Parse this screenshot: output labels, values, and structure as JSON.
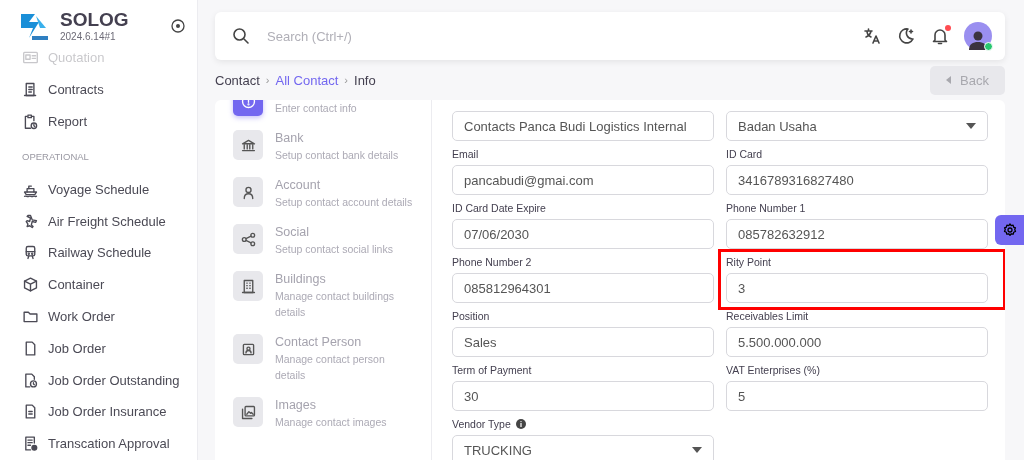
{
  "brand": {
    "name": "SOLOG",
    "version": "2024.6.14#1"
  },
  "sidebar": {
    "items": [
      {
        "kind": "item",
        "label": "Quotation",
        "faded": true
      },
      {
        "kind": "item",
        "label": "Contracts",
        "faded": false
      },
      {
        "kind": "item",
        "label": "Report",
        "faded": false
      },
      {
        "kind": "section",
        "label": "OPERATIONAL",
        "faded": false
      },
      {
        "kind": "item",
        "label": "Voyage Schedule",
        "faded": false
      },
      {
        "kind": "item",
        "label": "Air Freight Schedule",
        "faded": false
      },
      {
        "kind": "item",
        "label": "Railway Schedule",
        "faded": false
      },
      {
        "kind": "item",
        "label": "Container",
        "faded": false
      },
      {
        "kind": "item",
        "label": "Work Order",
        "faded": false
      },
      {
        "kind": "item",
        "label": "Job Order",
        "faded": false
      },
      {
        "kind": "item",
        "label": "Job Order Outstanding",
        "faded": false
      },
      {
        "kind": "item",
        "label": "Job Order Insurance",
        "faded": false
      },
      {
        "kind": "item",
        "label": "Transcation Approval",
        "faded": false
      }
    ]
  },
  "search": {
    "placeholder": "Search (Ctrl+/)"
  },
  "breadcrumb": [
    {
      "kind": "crumb",
      "label": "Contact",
      "link": false
    },
    {
      "kind": "separator",
      "label": "›"
    },
    {
      "kind": "crumb",
      "label": "All Contact",
      "link": true
    },
    {
      "kind": "separator",
      "label": "›"
    },
    {
      "kind": "crumb",
      "label": "Info",
      "link": false
    }
  ],
  "back_button": {
    "label": "Back",
    "disabled": true
  },
  "steps": [
    {
      "subtitle": "Enter contact info",
      "selected": true
    },
    {
      "title": "Bank",
      "subtitle": "Setup contact bank details",
      "selected": false
    },
    {
      "title": "Account",
      "subtitle": "Setup contact account details",
      "selected": false
    },
    {
      "title": "Social",
      "subtitle": "Setup contact social links",
      "selected": false
    },
    {
      "title": "Buildings",
      "subtitle": "Manage contact buildings details",
      "selected": false
    },
    {
      "title": "Contact Person",
      "subtitle": "Manage contact person details",
      "selected": false
    },
    {
      "title": "Images",
      "subtitle": "Manage contact images",
      "selected": false
    }
  ],
  "fields": [
    {
      "kind": "text",
      "value": "Contacts Panca Budi Logistics Internal",
      "info": false,
      "highlighted": false
    },
    {
      "kind": "select",
      "value": "Badan Usaha",
      "info": false,
      "highlighted": false
    },
    {
      "kind": "text",
      "label": "Email",
      "value": "pancabudi@gmai.com",
      "info": false,
      "highlighted": false
    },
    {
      "kind": "text",
      "label": "ID Card",
      "value": "3416789316827480",
      "info": false,
      "highlighted": false
    },
    {
      "kind": "text",
      "label": "ID Card Date Expire",
      "value": "07/06/2030",
      "info": false,
      "highlighted": false
    },
    {
      "kind": "text",
      "label": "Phone Number 1",
      "value": "085782632912",
      "info": false,
      "highlighted": false
    },
    {
      "kind": "text",
      "label": "Phone Number 2",
      "value": "085812964301",
      "info": false,
      "highlighted": false
    },
    {
      "kind": "text",
      "label": "Rity Point",
      "value": "3",
      "info": false,
      "highlighted": true
    },
    {
      "kind": "text",
      "label": "Position",
      "value": "Sales",
      "info": false,
      "highlighted": false
    },
    {
      "kind": "text",
      "label": "Receivables Limit",
      "value": "5.500.000.000",
      "info": false,
      "highlighted": false
    },
    {
      "kind": "text",
      "label": "Term of Payment",
      "value": "30",
      "info": false,
      "highlighted": false
    },
    {
      "kind": "text",
      "label": "VAT Enterprises (%)",
      "value": "5",
      "info": false,
      "highlighted": false
    },
    {
      "kind": "select",
      "label": "Vendor Type",
      "value": "TRUCKING",
      "info": true,
      "highlighted": false
    }
  ]
}
